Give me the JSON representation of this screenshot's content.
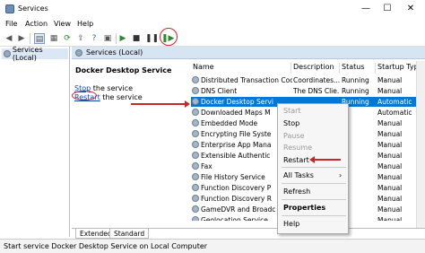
{
  "window": {
    "title": "Services",
    "minimize": "—",
    "maximize": "☐",
    "close": "✕"
  },
  "menu": [
    "File",
    "Action",
    "View",
    "Help"
  ],
  "tree": {
    "label": "Services (Local)"
  },
  "panel": {
    "title": "Services (Local)"
  },
  "detail": {
    "service_name": "Docker Desktop Service",
    "stop_link": "Stop",
    "stop_rest": " the service",
    "restart_link": "Restart",
    "restart_rest": " the service"
  },
  "columns": [
    "Name",
    "Description",
    "Status",
    "Startup Type"
  ],
  "rows": [
    {
      "name": "Distributed Transaction Coor...",
      "desc": "Coordinates...",
      "status": "Running",
      "startup": "Manual"
    },
    {
      "name": "DNS Client",
      "desc": "The DNS Clie...",
      "status": "Running",
      "startup": "Manual"
    },
    {
      "name": "Docker Desktop Servi",
      "desc": "",
      "status": "Running",
      "startup": "Automatic",
      "selected": true
    },
    {
      "name": "Downloaded Maps M",
      "desc": "",
      "status": "",
      "startup": "Automatic"
    },
    {
      "name": "Embedded Mode",
      "desc": "",
      "status": "",
      "startup": "Manual"
    },
    {
      "name": "Encrypting File Syste",
      "desc": "",
      "status": "",
      "startup": "Manual"
    },
    {
      "name": "Enterprise App Mana",
      "desc": "",
      "status": "",
      "startup": "Manual"
    },
    {
      "name": "Extensible Authentic",
      "desc": "",
      "status": "",
      "startup": "Manual"
    },
    {
      "name": "Fax",
      "desc": "",
      "status": "",
      "startup": "Manual"
    },
    {
      "name": "File History Service",
      "desc": "",
      "status": "",
      "startup": "Manual"
    },
    {
      "name": "Function Discovery P",
      "desc": "",
      "status": "",
      "startup": "Manual"
    },
    {
      "name": "Function Discovery R",
      "desc": "",
      "status": "",
      "startup": "Manual"
    },
    {
      "name": "GameDVR and Broadc",
      "desc": "",
      "status": "",
      "startup": "Manual"
    },
    {
      "name": "Geolocation Service",
      "desc": "",
      "status": "",
      "startup": "Manual"
    }
  ],
  "context_menu": {
    "start": "Start",
    "stop": "Stop",
    "pause": "Pause",
    "resume": "Resume",
    "restart": "Restart",
    "all_tasks": "All Tasks",
    "submenu_arrow": "›",
    "refresh": "Refresh",
    "properties": "Properties",
    "help": "Help"
  },
  "tabs": [
    "Extended",
    "Standard"
  ],
  "status_text": "Start service Docker Desktop Service on Local Computer",
  "colors": {
    "selection": "#0078d7",
    "annotation": "#c82828",
    "panel_header": "#d7e4f2"
  },
  "icons": [
    "back-arrow-icon",
    "forward-arrow-icon",
    "console-tree-icon",
    "properties-icon",
    "refresh-icon",
    "export-icon",
    "help-icon",
    "play-icon",
    "stop-icon",
    "pause-icon",
    "resume-icon"
  ]
}
